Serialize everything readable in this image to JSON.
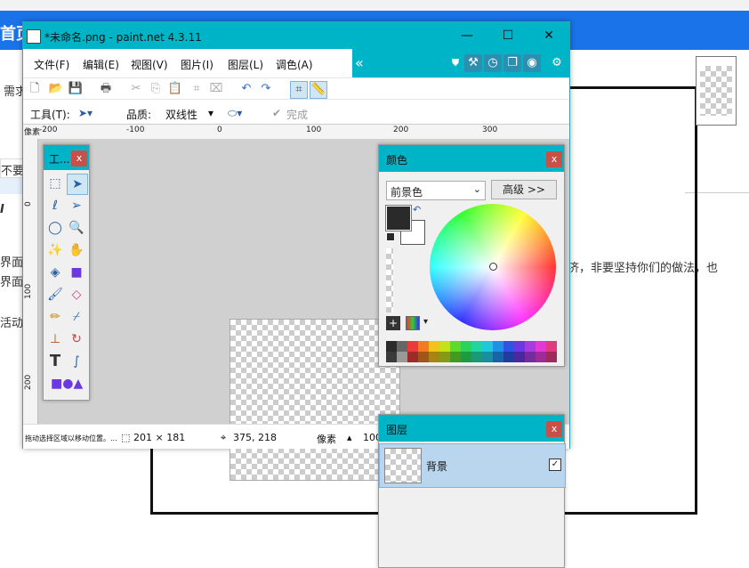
{
  "background_page": {
    "header_text": "首页",
    "text_need": "需求",
    "text_nonew": "不要",
    "text_jiemian1": "界面",
    "text_jiemian2": "界面",
    "text_huodong": "活动",
    "text_right": "济，非要坚持你们的做法，也",
    "italic_glyph": "I"
  },
  "window": {
    "title": "*未命名.png - paint.net 4.3.11",
    "minimize": "—",
    "maximize": "☐",
    "close": "✕"
  },
  "menu": {
    "items": [
      "文件(F)",
      "编辑(E)",
      "视图(V)",
      "图片(I)",
      "图层(L)",
      "调色(A)"
    ],
    "scroll_left": "«",
    "scroll_right": "»"
  },
  "toolbar2": {
    "tool_label": "工具(T):",
    "quality_label": "品质:",
    "quality_value": "双线性",
    "finish_label": "完成"
  },
  "ruler": {
    "unit": "像素",
    "h_labels": [
      "-200",
      "-100",
      "0",
      "100",
      "200",
      "300"
    ],
    "v_labels": [
      "0",
      "100",
      "200"
    ]
  },
  "status": {
    "hint": "拖动选择区域以移动位置。...",
    "size": "201 × 181",
    "cursor": "375, 218",
    "unit": "像素",
    "zoom": "100"
  },
  "tools_window": {
    "title": "工...",
    "close": "x"
  },
  "colors_window": {
    "title": "颜色",
    "close": "x",
    "mode_select": "前景色",
    "advanced_button": "高级 >>",
    "primary_color": "#2a2a2a",
    "secondary_color": "#ffffff",
    "palette_top": [
      "#2b2b2b",
      "#666666",
      "#e93b3b",
      "#f07b22",
      "#f2c21b",
      "#c6e11c",
      "#5fd92a",
      "#2bd35a",
      "#21d4a0",
      "#1fc8d8",
      "#1f90e6",
      "#2e55e0",
      "#6a3ae0",
      "#a63be0",
      "#e03ad6",
      "#e03a80"
    ],
    "palette_bottom": [
      "#3a3a3a",
      "#999999",
      "#9e2a2a",
      "#a3541a",
      "#a68612",
      "#879a14",
      "#429a1e",
      "#1e9a40",
      "#189a74",
      "#178f9c",
      "#1764a6",
      "#213ca0",
      "#4a29a0",
      "#782aa0",
      "#a02a98",
      "#a02a5c"
    ]
  },
  "layers_window": {
    "title": "图层",
    "close": "x",
    "layer_name": "背景",
    "layer_visible": "✓"
  }
}
